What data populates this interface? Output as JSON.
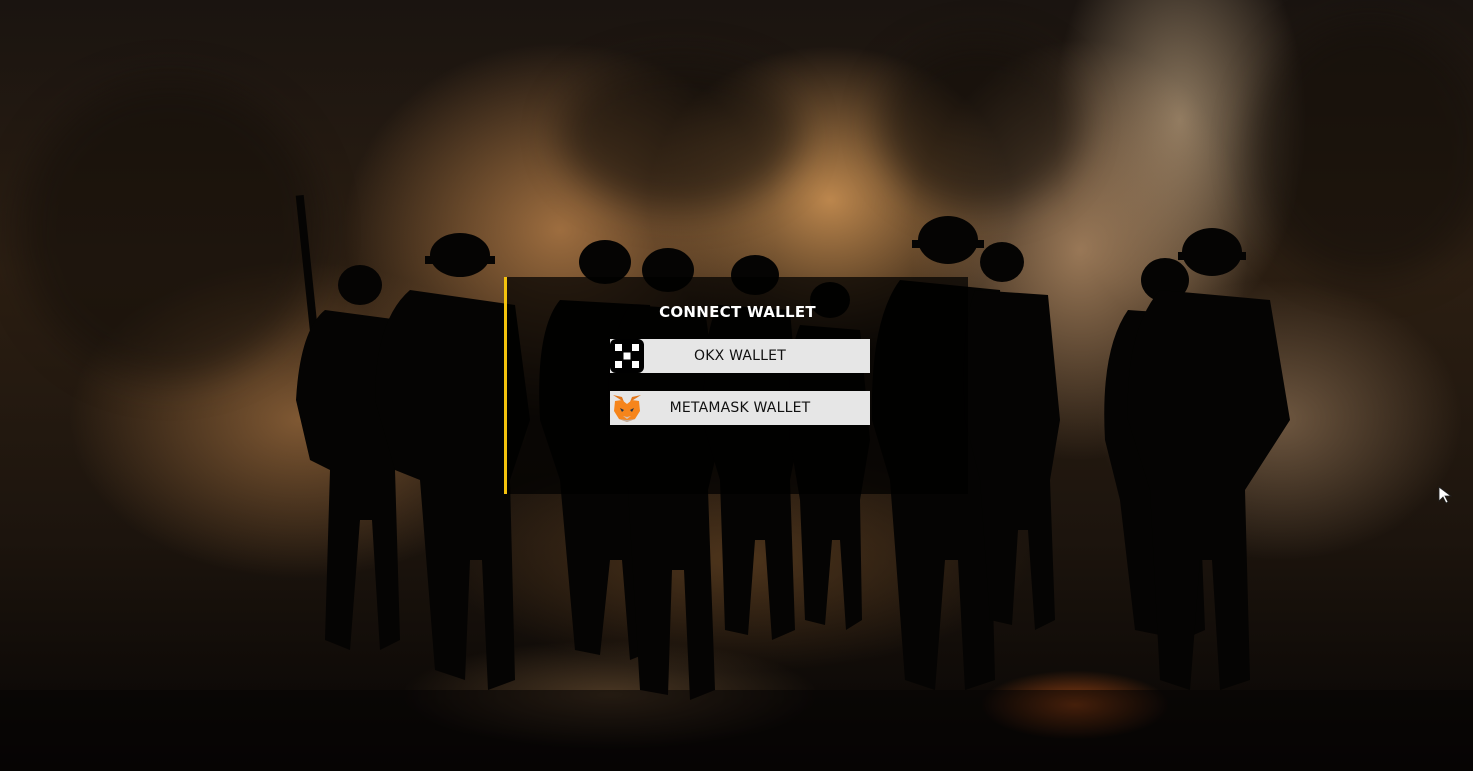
{
  "modal": {
    "title": "CONNECT WALLET",
    "accent_color": "#f4c20d",
    "wallets": [
      {
        "label": "OKX WALLET",
        "icon": "okx-icon"
      },
      {
        "label": "METAMASK WALLET",
        "icon": "metamask-fox-icon"
      }
    ]
  },
  "background": {
    "image": "soldier-silhouettes-in-smoke"
  },
  "cursor": {
    "icon": "mouse-pointer-icon"
  }
}
